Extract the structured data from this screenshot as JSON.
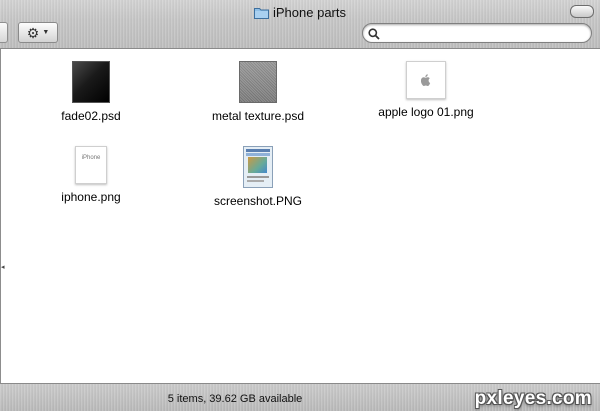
{
  "window": {
    "title": "iPhone parts",
    "folder_icon": "folder-icon"
  },
  "toolbar": {
    "action_icon": "gear-icon",
    "search": {
      "placeholder": "",
      "value": "",
      "icon": "search-icon"
    }
  },
  "files": [
    {
      "name": "fade02.psd",
      "icon": "psd-thumbnail-dark"
    },
    {
      "name": "metal texture.psd",
      "icon": "psd-thumbnail-metal"
    },
    {
      "name": "apple logo 01.png",
      "icon": "png-thumbnail-apple",
      "thumb_text": ""
    },
    {
      "name": "iphone.png",
      "icon": "png-thumbnail-iphone",
      "thumb_text": "iPhone"
    },
    {
      "name": "screenshot.PNG",
      "icon": "png-thumbnail-screenshot"
    }
  ],
  "status": {
    "text": "5 items, 39.62 GB available"
  },
  "watermark": "pxleyes.com",
  "colors": {
    "metal": "#c2c2c2",
    "content_bg": "#ffffff",
    "watermark": "#ffffff"
  }
}
